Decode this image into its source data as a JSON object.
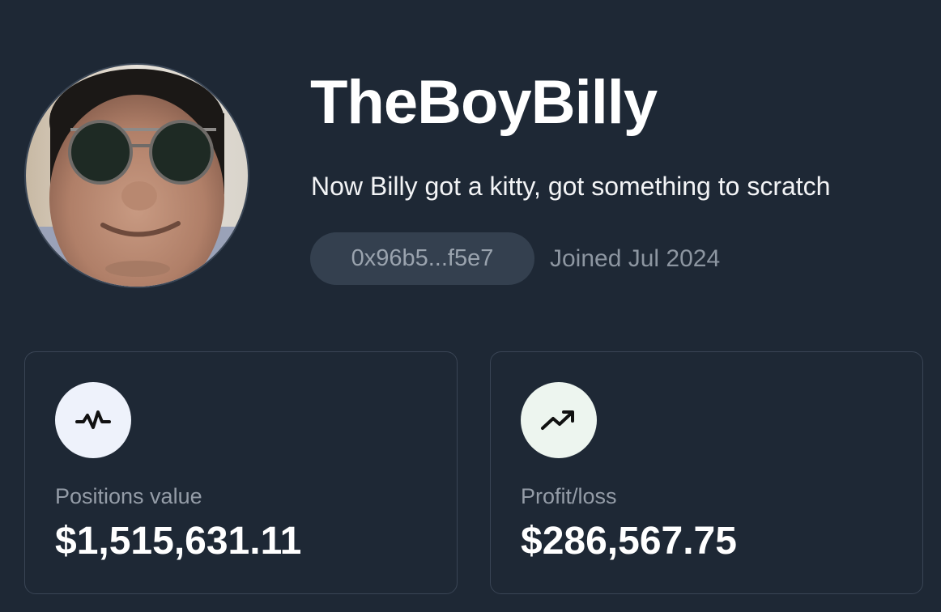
{
  "profile": {
    "username": "TheBoyBilly",
    "bio": "Now Billy got a kitty, got something to scratch",
    "address": "0x96b5...f5e7",
    "joined": "Joined Jul 2024",
    "avatar_icon": "profile-photo"
  },
  "stats": [
    {
      "label": "Positions value",
      "value": "$1,515,631.11",
      "icon": "activity-pulse-icon",
      "icon_bg": "#eef2fb"
    },
    {
      "label": "Profit/loss",
      "value": "$286,567.75",
      "icon": "trending-up-icon",
      "icon_bg": "#edf5ef"
    }
  ],
  "colors": {
    "background": "#1e2835",
    "card_border": "#3a4555",
    "chip_background": "#34404f",
    "muted_text": "#949ca7"
  }
}
